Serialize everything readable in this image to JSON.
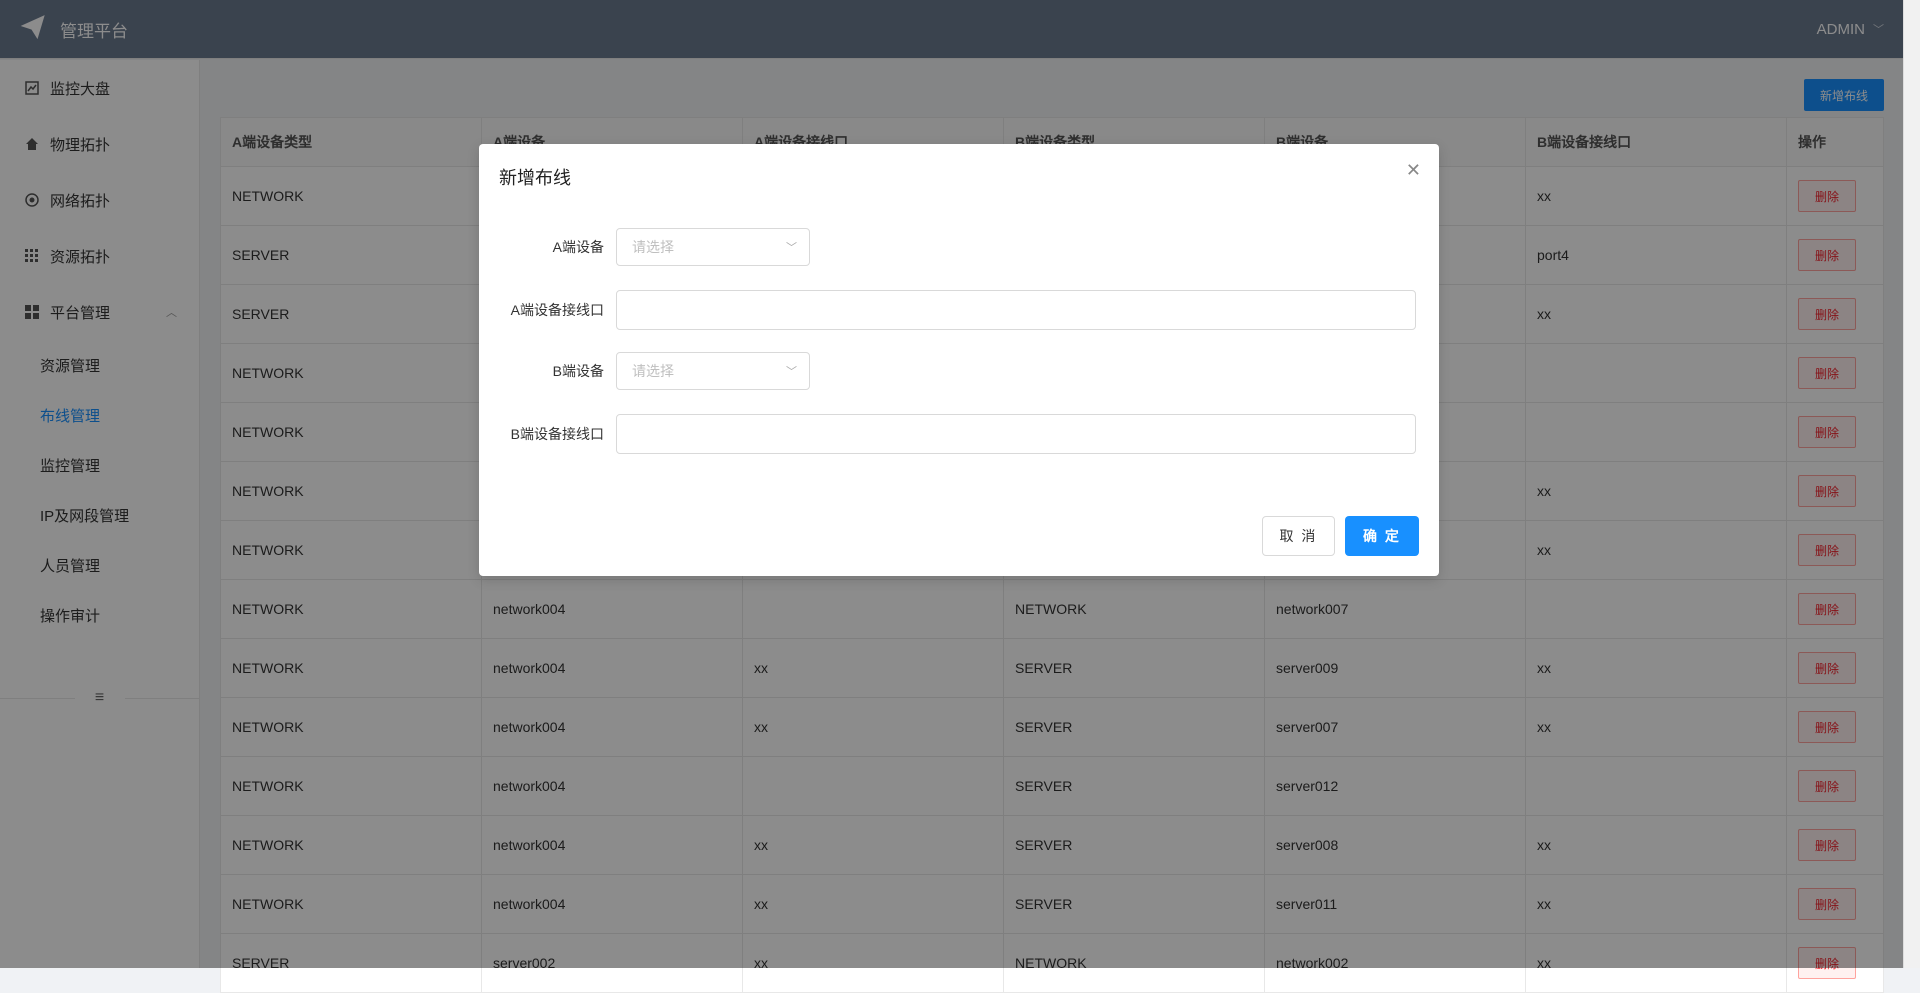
{
  "header": {
    "app_title": "管理平台",
    "user_name": "ADMIN"
  },
  "sidebar": {
    "items": [
      {
        "label": "监控大盘",
        "icon": "chart-icon"
      },
      {
        "label": "物理拓扑",
        "icon": "home-icon"
      },
      {
        "label": "网络拓扑",
        "icon": "globe-icon"
      },
      {
        "label": "资源拓扑",
        "icon": "grid-icon"
      },
      {
        "label": "平台管理",
        "icon": "apps-icon"
      }
    ],
    "sub_items": [
      {
        "label": "资源管理"
      },
      {
        "label": "布线管理"
      },
      {
        "label": "监控管理"
      },
      {
        "label": "IP及网段管理"
      },
      {
        "label": "人员管理"
      },
      {
        "label": "操作审计"
      }
    ],
    "collapse_icon": "≡"
  },
  "main": {
    "add_button": "新增布线",
    "columns": [
      "A端设备类型",
      "A端设备",
      "A端设备接线口",
      "B端设备类型",
      "B端设备",
      "B端设备接线口",
      "操作"
    ],
    "delete_label": "删除",
    "rows": [
      [
        "NETWORK",
        "",
        "",
        "",
        "",
        "xx"
      ],
      [
        "SERVER",
        "",
        "",
        "",
        "",
        "port4"
      ],
      [
        "SERVER",
        "",
        "",
        "",
        "",
        "xx"
      ],
      [
        "NETWORK",
        "",
        "",
        "",
        "",
        ""
      ],
      [
        "NETWORK",
        "",
        "",
        "",
        "",
        ""
      ],
      [
        "NETWORK",
        "",
        "",
        "",
        "",
        "xx"
      ],
      [
        "NETWORK",
        "",
        "",
        "",
        "",
        "xx"
      ],
      [
        "NETWORK",
        "network004",
        "",
        "NETWORK",
        "network007",
        ""
      ],
      [
        "NETWORK",
        "network004",
        "xx",
        "SERVER",
        "server009",
        "xx"
      ],
      [
        "NETWORK",
        "network004",
        "xx",
        "SERVER",
        "server007",
        "xx"
      ],
      [
        "NETWORK",
        "network004",
        "",
        "SERVER",
        "server012",
        ""
      ],
      [
        "NETWORK",
        "network004",
        "xx",
        "SERVER",
        "server008",
        "xx"
      ],
      [
        "NETWORK",
        "network004",
        "xx",
        "SERVER",
        "server011",
        "xx"
      ],
      [
        "SERVER",
        "server002",
        "xx",
        "NETWORK",
        "network002",
        "xx"
      ]
    ]
  },
  "modal": {
    "title": "新增布线",
    "a_device_label": "A端设备",
    "a_device_placeholder": "请选择",
    "a_port_label": "A端设备接线口",
    "a_port_value": "",
    "b_device_label": "B端设备",
    "b_device_placeholder": "请选择",
    "b_port_label": "B端设备接线口",
    "b_port_value": "",
    "cancel_label": "取 消",
    "ok_label": "确 定"
  }
}
